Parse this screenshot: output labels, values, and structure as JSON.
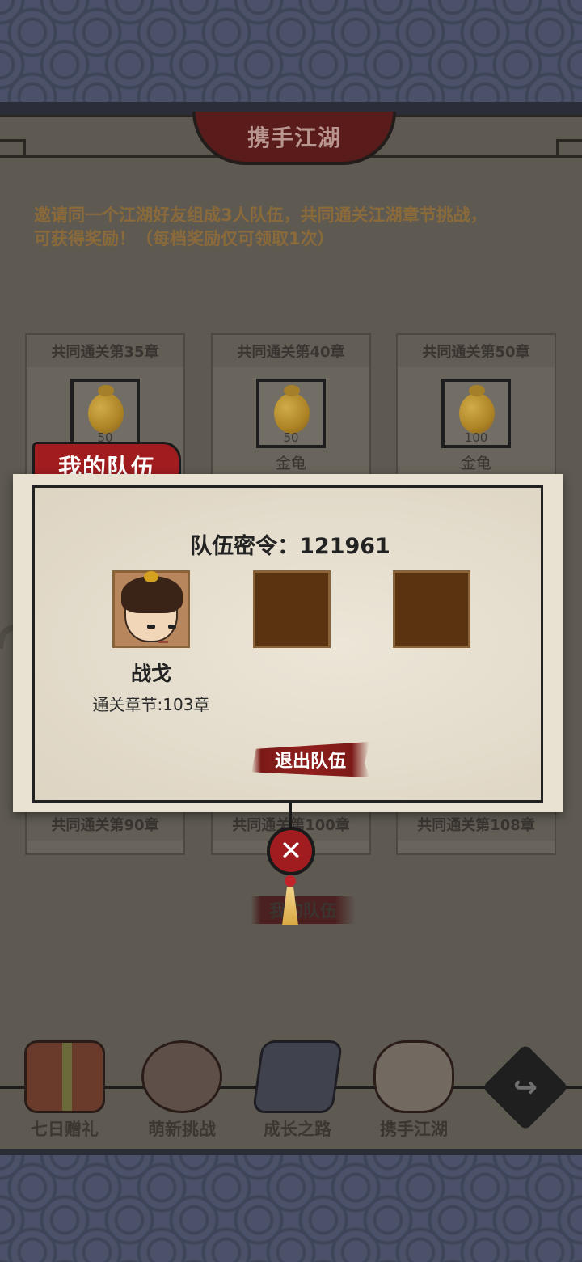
{
  "page_title": "携手江湖",
  "intro_text": {
    "line1": "邀请同一个江湖好友组成3人队伍，共同通关江湖章节挑战，",
    "line2": "可获得奖励！（每档奖励仅可领取1次）"
  },
  "reward_cards_top": [
    {
      "title": "共同通关第35章",
      "count": "50",
      "name": ""
    },
    {
      "title": "共同通关第40章",
      "count": "50",
      "name": "金龟"
    },
    {
      "title": "共同通关第50章",
      "count": "100",
      "name": "金龟"
    }
  ],
  "reward_cards_bottom": [
    {
      "title": "共同通关第90章"
    },
    {
      "title": "共同通关第100章"
    },
    {
      "title": "共同通关第108章"
    }
  ],
  "background_button_label": "我的队伍",
  "modal": {
    "tab_label": "我的队伍",
    "team_code_label": "队伍密令：121961",
    "member": {
      "name": "战戈",
      "chapter": "通关章节:103章"
    },
    "quit_label": "退出队伍",
    "close_label": "✕"
  },
  "bottom_nav": [
    {
      "label": "七日赠礼",
      "icon": "gift-box-icon"
    },
    {
      "label": "萌新挑战",
      "icon": "girl-portrait-icon"
    },
    {
      "label": "成长之路",
      "icon": "book-icon"
    },
    {
      "label": "携手江湖",
      "icon": "handshake-icon"
    }
  ],
  "share_icon": "↪",
  "colors": {
    "accent_red": "#a01c1f",
    "slot_brown": "#5a3310",
    "parchment": "#e9e2d3"
  }
}
